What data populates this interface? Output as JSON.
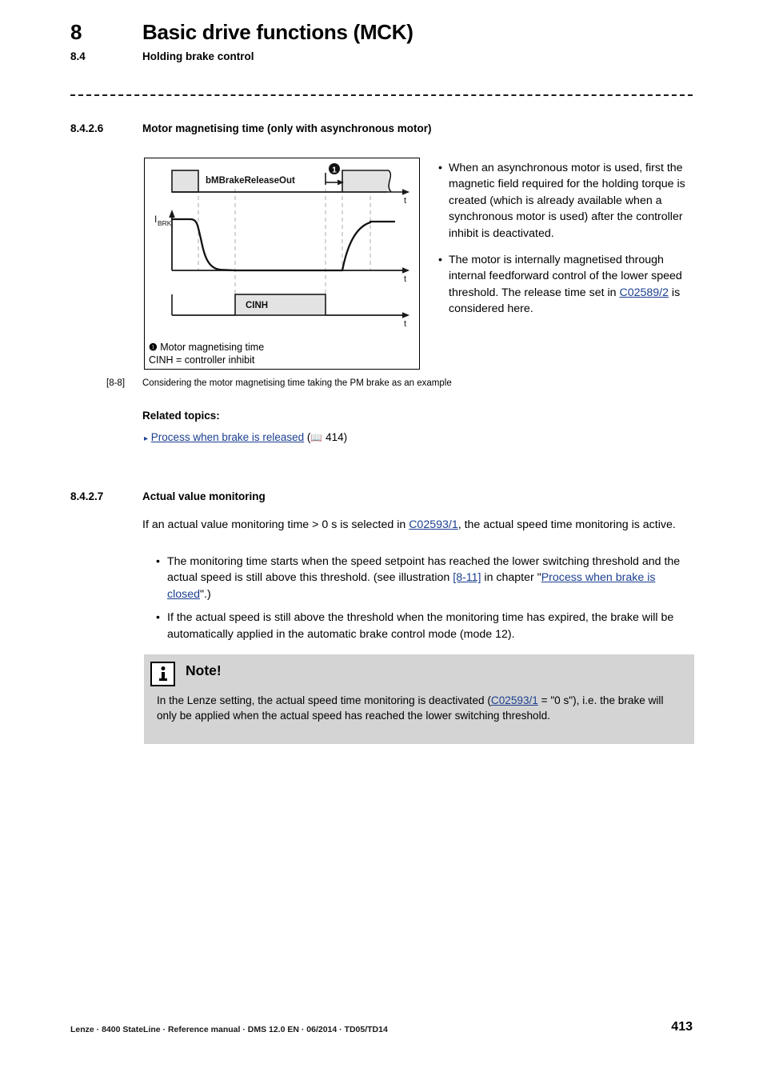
{
  "header": {
    "chapter_number": "8",
    "chapter_title": "Basic drive functions (MCK)",
    "section_number": "8.4",
    "section_title": "Holding brake control"
  },
  "section_826": {
    "number": "8.4.2.6",
    "title": "Motor magnetising time (only with asynchronous motor)",
    "bullets": [
      "When an asynchronous motor is used, first the magnetic field required for the holding torque is created (which is already available when a synchronous motor is used) after the controller inhibit is deactivated.",
      "The motor is internally magnetised through internal feedforward control of the lower speed threshold. The release time set in "
    ],
    "bullet2_link": "C02589/2",
    "bullet2_tail": " is considered here."
  },
  "figure": {
    "signal_label": "bMBrakeReleaseOut",
    "current_label_main": "I",
    "current_label_sub": "BRK",
    "cinh_label": "CINH",
    "time_axis_label": "t",
    "marker": "❶",
    "legend_marker_text": "Motor magnetising time",
    "legend_cinh_text": "CINH = controller inhibit",
    "caption_number": "[8-8]",
    "caption_text": "Considering the motor magnetising time taking the PM brake as an example"
  },
  "related": {
    "title": "Related topics:",
    "triangle": "▸",
    "link_text": "Process when brake is released",
    "book_icon": "📖",
    "page_ref": "414",
    "paren_open": "(",
    "paren_close": ")"
  },
  "section_827": {
    "number": "8.4.2.7",
    "title": "Actual value monitoring",
    "intro_pre": "If an actual value monitoring time > 0 s is selected in ",
    "intro_link": "C02593/1",
    "intro_post": ", the actual speed time monitoring is active.",
    "bullets": [
      {
        "pre": "The monitoring time starts when the speed setpoint has reached the lower switching threshold and the actual speed is still above this threshold. (see illustration ",
        "link1": "[8-11]",
        "mid": " in chapter \"",
        "link2": "Process when brake is closed",
        "post": "\".)"
      },
      {
        "pre": "If the actual speed is still above the threshold when the monitoring time has expired, the brake will be automatically applied in the automatic brake control mode (mode 12).",
        "link1": "",
        "mid": "",
        "link2": "",
        "post": ""
      }
    ]
  },
  "note": {
    "title": "Note!",
    "text_pre": "In the Lenze setting, the actual speed time monitoring is deactivated (",
    "link": "C02593/1",
    "text_post": " = \"0 s\"), i.e. the brake will only be applied when the actual speed has reached the lower switching threshold."
  },
  "footer": {
    "text": "Lenze · 8400 StateLine · Reference manual · DMS 12.0 EN · 06/2014 · TD05/TD14",
    "page_number": "413"
  },
  "colors": {
    "link": "#1b3f8f",
    "note_bg": "#d4d4d4",
    "block_fill": "#e3e3e3"
  }
}
